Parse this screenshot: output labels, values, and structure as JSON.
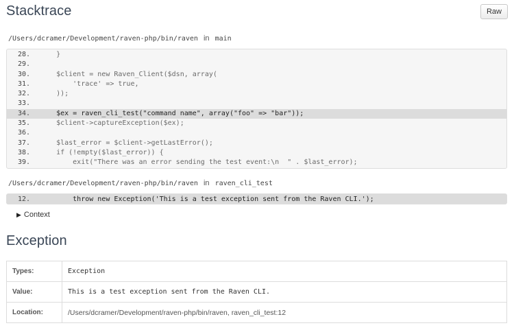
{
  "stacktrace": {
    "title": "Stacktrace",
    "raw_label": "Raw",
    "frames": [
      {
        "file": "/Users/dcramer/Development/raven-php/bin/raven",
        "in_label": "in",
        "function": "main",
        "lines": [
          {
            "num": "28.",
            "code": "    }"
          },
          {
            "num": "29.",
            "code": ""
          },
          {
            "num": "30.",
            "code": "    $client = new Raven_Client($dsn, array("
          },
          {
            "num": "31.",
            "code": "        'trace' => true,"
          },
          {
            "num": "32.",
            "code": "    ));"
          },
          {
            "num": "33.",
            "code": ""
          },
          {
            "num": "34.",
            "code": "    $ex = raven_cli_test(\"command name\", array(\"foo\" => \"bar\"));",
            "active": true
          },
          {
            "num": "35.",
            "code": "    $client->captureException($ex);"
          },
          {
            "num": "36.",
            "code": ""
          },
          {
            "num": "37.",
            "code": "    $last_error = $client->getLastError();"
          },
          {
            "num": "38.",
            "code": "    if (!empty($last_error)) {"
          },
          {
            "num": "39.",
            "code": "        exit(\"There was an error sending the test event:\\n  \" . $last_error);"
          }
        ]
      },
      {
        "file": "/Users/dcramer/Development/raven-php/bin/raven",
        "in_label": "in",
        "function": "raven_cli_test",
        "lines": [
          {
            "num": "12.",
            "code": "        throw new Exception('This is a test exception sent from the Raven CLI.');",
            "active": true
          }
        ],
        "context_label": "Context"
      }
    ]
  },
  "exception": {
    "title": "Exception",
    "rows": [
      {
        "key": "Types:",
        "value": "Exception"
      },
      {
        "key": "Value:",
        "value": "This is a test exception sent from the Raven CLI."
      },
      {
        "key": "Location:",
        "value": "/Users/dcramer/Development/raven-php/bin/raven, raven_cli_test:12"
      }
    ]
  },
  "icons": {
    "context_toggle": "triangle-right-icon"
  }
}
